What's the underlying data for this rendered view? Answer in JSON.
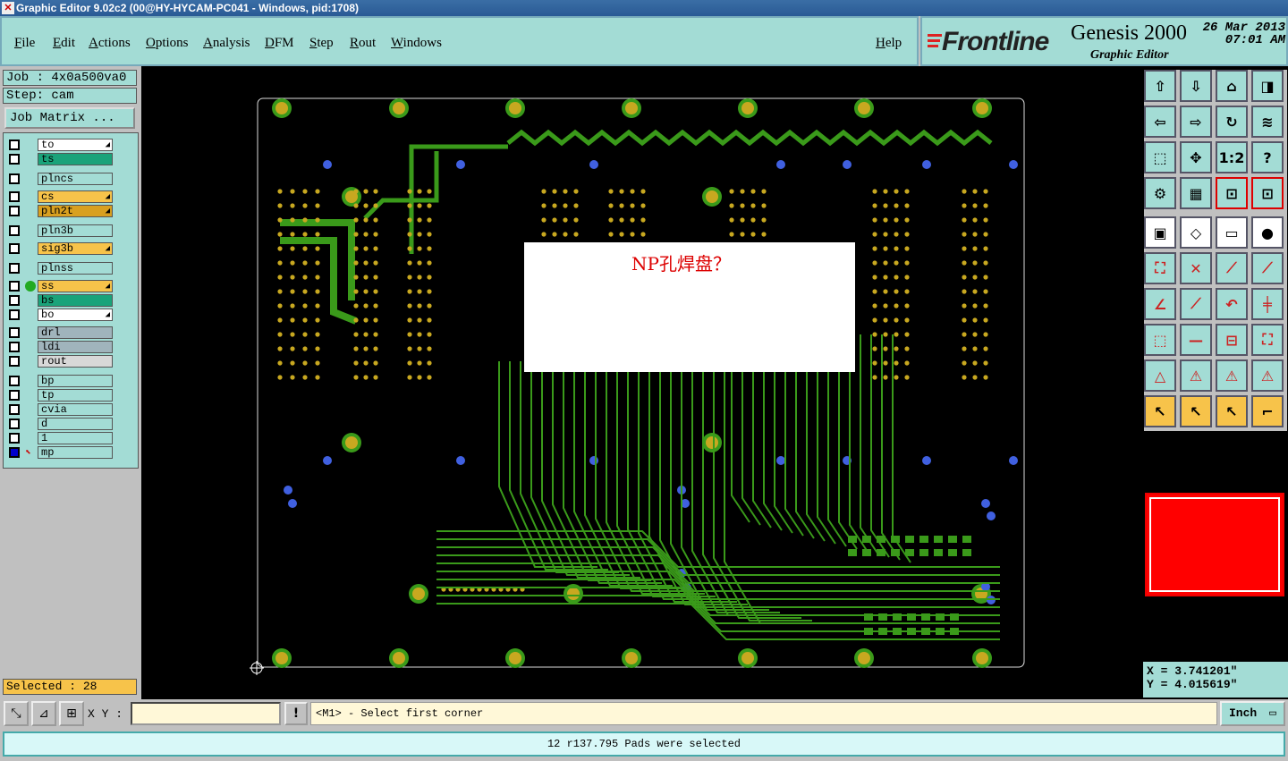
{
  "window": {
    "title": "Graphic Editor 9.02c2 (00@HY-HYCAM-PC041 - Windows, pid:1708)"
  },
  "menu": {
    "items": [
      "File",
      "Edit",
      "Actions",
      "Options",
      "Analysis",
      "DFM",
      "Step",
      "Rout",
      "Windows"
    ],
    "help": "Help"
  },
  "brand": {
    "logo": "Frontline",
    "product": "Genesis 2000",
    "subtitle": "Graphic Editor",
    "date": "26 Mar 2013",
    "time": "07:01 AM"
  },
  "job": {
    "job_label": "Job : 4x0a500va0",
    "step_label": "Step: cam",
    "matrix_button": "Job Matrix ..."
  },
  "layers": [
    {
      "name": "to",
      "color": "#ffffff",
      "arrow": true
    },
    {
      "name": "ts",
      "color": "#1aa37a",
      "arrow": false
    },
    {
      "name": "plncs",
      "color": "#a3dcd5",
      "arrow": false
    },
    {
      "name": "cs",
      "color": "#f7c34a",
      "arrow": true
    },
    {
      "name": "pln2t",
      "color": "#d8a020",
      "arrow": true
    },
    {
      "name": "pln3b",
      "color": "#a3dcd5",
      "arrow": false
    },
    {
      "name": "sig3b",
      "color": "#f7c34a",
      "arrow": true
    },
    {
      "name": "plnss",
      "color": "#a3dcd5",
      "arrow": false
    },
    {
      "name": "ss",
      "color": "#f7c34a",
      "arrow": true
    },
    {
      "name": "bs",
      "color": "#1aa37a",
      "arrow": false
    },
    {
      "name": "bo",
      "color": "#ffffff",
      "arrow": true
    },
    {
      "name": "drl",
      "color": "#a0b4bc",
      "arrow": false
    },
    {
      "name": "ldi",
      "color": "#a0b4bc",
      "arrow": false
    },
    {
      "name": "rout",
      "color": "#d8d8d8",
      "arrow": false
    },
    {
      "name": "bp",
      "color": "#a3dcd5",
      "arrow": false
    },
    {
      "name": "tp",
      "color": "#a3dcd5",
      "arrow": false
    },
    {
      "name": "cvia",
      "color": "#a3dcd5",
      "arrow": false
    },
    {
      "name": "d",
      "color": "#a3dcd5",
      "arrow": false
    },
    {
      "name": "1",
      "color": "#a3dcd5",
      "arrow": false
    },
    {
      "name": "mp",
      "color": "#a3dcd5",
      "arrow": false
    }
  ],
  "selected": {
    "label": "Selected : 28"
  },
  "popup": {
    "text": "NP孔焊盘？"
  },
  "coords": {
    "x": "X = 3.741201\"",
    "y": "Y = 4.015619\""
  },
  "bottom": {
    "xy_label": "X Y :",
    "xy_value": "",
    "prompt": "<M1> - Select first corner",
    "unit": "Inch"
  },
  "status": {
    "text": "12 r137.795 Pads were selected"
  },
  "colors": {
    "panel": "#a3dcd5",
    "trace": "#3a9a1a",
    "pad": "#c8a820",
    "via": "#4060e0",
    "accent_red": "#ff0000"
  }
}
